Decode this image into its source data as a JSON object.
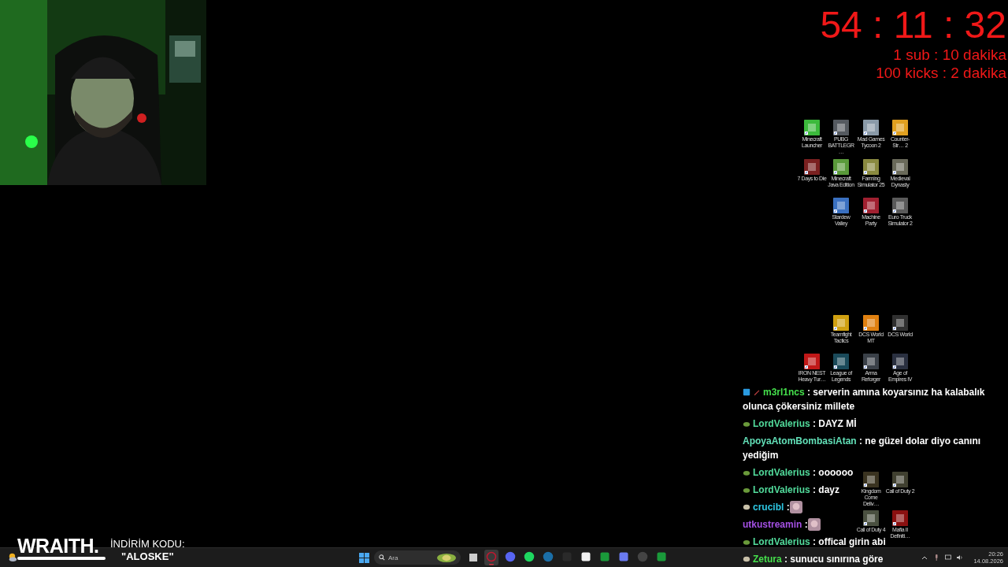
{
  "timer": {
    "time": "54 : 11 : 32",
    "rules": [
      "1 sub : 10 dakika",
      "100 kicks : 2 dakika"
    ]
  },
  "desktop_icons": [
    {
      "label": "Minecraft Launcher"
    },
    {
      "label": "PUBG BATTLEGR…"
    },
    {
      "label": "Mad Games Tycoon 2"
    },
    {
      "label": "Counter-Str… 2"
    },
    {
      "label": "7 Days to Die"
    },
    {
      "label": "Minecraft Java Edition"
    },
    {
      "label": "Farming Simulator 25"
    },
    {
      "label": "Medieval Dynasty"
    },
    {
      "label": "Stardew Valley"
    },
    {
      "label": "Machine Party"
    },
    {
      "label": "Euro Truck Simulator 2"
    },
    {
      "label": "Teamfight Tactics"
    },
    {
      "label": "DCS World MT"
    },
    {
      "label": "DCS World"
    },
    {
      "label": "IRON NEST Heavy Tur…"
    },
    {
      "label": "League of Legends"
    },
    {
      "label": "Arma Reforger"
    },
    {
      "label": "Age of Empires IV"
    },
    {
      "label": "Kingdom Come Deliv…"
    },
    {
      "label": "Call of Duty 2"
    },
    {
      "label": "Call of Duty 4"
    },
    {
      "label": "Mafia II Definiti…"
    }
  ],
  "chat": [
    {
      "user": "m3rl1ncs",
      "color": "#45e04c",
      "badges": [
        {
          "kind": "cube"
        },
        {
          "kind": "sword"
        }
      ],
      "text": ": serverin amına koyarsınız ha kalabalık olunca çökersiniz millete"
    },
    {
      "user": "LordValerius",
      "color": "#52dc9c",
      "badges": [
        {
          "kind": "turtle"
        }
      ],
      "text": ": DAYZ Mİ"
    },
    {
      "user": "ApoyaAtomBombasiAtan",
      "color": "#62e0b8",
      "text": ": ne güzel dolar diyo canını yediğim"
    },
    {
      "user": "LordValerius",
      "color": "#52dc9c",
      "badges": [
        {
          "kind": "turtle"
        }
      ],
      "text": ": oooooo"
    },
    {
      "user": "LordValerius",
      "color": "#52dc9c",
      "badges": [
        {
          "kind": "turtle"
        }
      ],
      "text": ": dayz"
    },
    {
      "user": "crucibl",
      "color": "#2ec8e4",
      "badges": [
        {
          "kind": "cookie"
        }
      ],
      "text": ":",
      "emote": true
    },
    {
      "user": "utkustreamin",
      "color": "#a450e4",
      "text": ":",
      "emote": true
    },
    {
      "user": "LordValerius",
      "color": "#52dc9c",
      "badges": [
        {
          "kind": "turtle"
        }
      ],
      "text": ": offical girin abi"
    },
    {
      "user": "Zetura",
      "color": "#45e04c",
      "badges": [
        {
          "kind": "cookie"
        }
      ],
      "text": ": sunucu sınırına göre"
    }
  ],
  "sponsor": {
    "brand": "WRAITH.",
    "label": "İNDİRİM KODU:",
    "code": "\"ALOSKE\""
  },
  "taskbar": {
    "search": {
      "placeholder": "Ara"
    },
    "apps": [
      {
        "kind": "taskview",
        "active": false
      },
      {
        "kind": "opera",
        "active": true
      },
      {
        "kind": "discord",
        "active": false
      },
      {
        "kind": "spotify",
        "active": false
      },
      {
        "kind": "steam",
        "active": false
      },
      {
        "kind": "epic",
        "active": false
      },
      {
        "kind": "capcut",
        "active": false
      },
      {
        "kind": "xbox",
        "active": false
      },
      {
        "kind": "copilot",
        "active": false
      },
      {
        "kind": "obs",
        "active": false
      },
      {
        "kind": "xbox",
        "active": false
      }
    ],
    "time": "20:26",
    "date": "14.08.2026"
  }
}
